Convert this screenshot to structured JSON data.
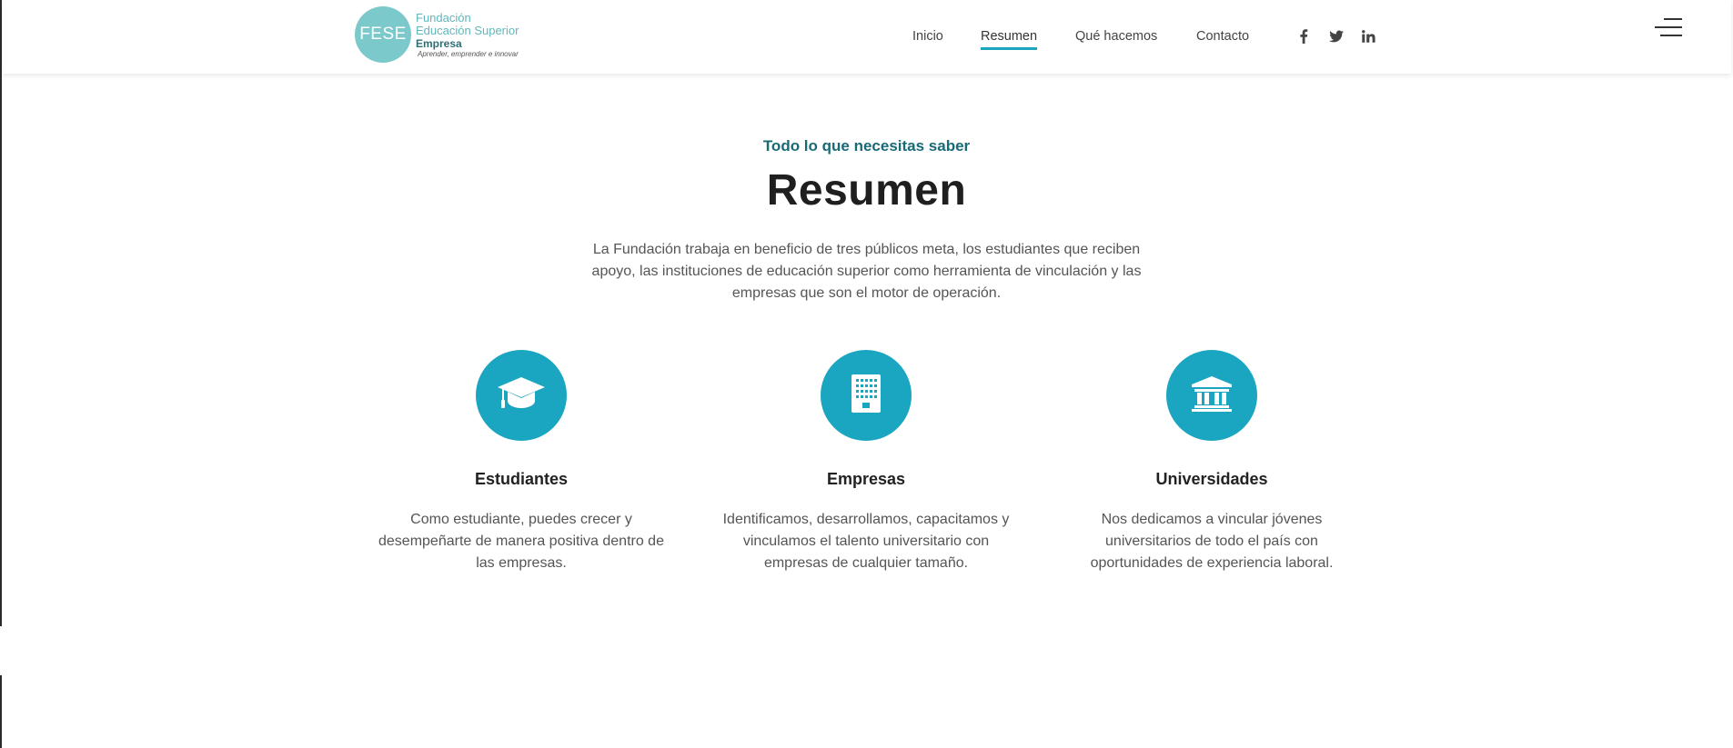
{
  "header": {
    "logo": {
      "mark": "FESE",
      "line1": "Fundación",
      "line2": "Educación Superior",
      "line3": "Empresa",
      "tagline": "Aprender, emprender e innovar"
    },
    "nav": [
      {
        "label": "Inicio",
        "active": false
      },
      {
        "label": "Resumen",
        "active": true
      },
      {
        "label": "Qué hacemos",
        "active": false
      },
      {
        "label": "Contacto",
        "active": false
      }
    ],
    "social": [
      "facebook-icon",
      "twitter-icon",
      "linkedin-icon"
    ],
    "menu_icon": "hamburger-menu-icon"
  },
  "section": {
    "kicker": "Todo lo que necesitas saber",
    "title": "Resumen",
    "intro": "La Fundación trabaja en beneficio de tres públicos meta, los estudiantes que reciben apoyo, las instituciones de educación superior como herramienta de vinculación y las empresas que son el motor de operación.",
    "features": [
      {
        "icon": "graduation-cap-icon",
        "title": "Estudiantes",
        "text": "Como estudiante, puedes crecer y desempeñarte de manera positiva dentro de las empresas."
      },
      {
        "icon": "building-icon",
        "title": "Empresas",
        "text": "Identificamos, desarrollamos, capacitamos y vinculamos el talento universitario con empresas de cualquier tamaño."
      },
      {
        "icon": "university-icon",
        "title": "Universidades",
        "text": "Nos dedicamos a vincular jóvenes universitarios de todo el país con oportunidades de experiencia laboral."
      }
    ]
  },
  "colors": {
    "accent": "#1aa6c0",
    "kicker": "#186a77",
    "logo": "#7cc9cb"
  }
}
